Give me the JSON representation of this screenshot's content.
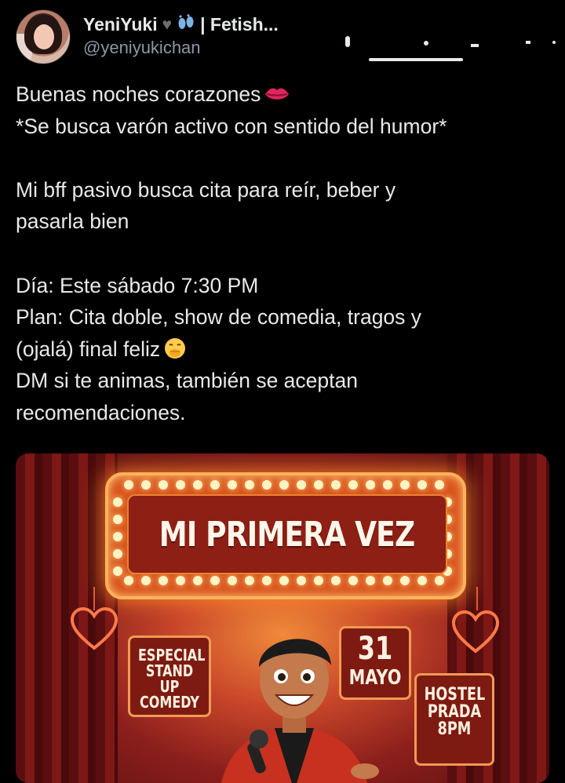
{
  "tweet": {
    "author": {
      "display_name": "YeniYuki",
      "name_suffix": "| Fetish...",
      "handle": "@yeniyukichan",
      "badges": [
        "black-heart-icon",
        "footprints-icon"
      ]
    },
    "lines": [
      "Buenas noches corazones",
      "*Se busca varón activo con sentido del humor*",
      "",
      "Mi bff pasivo busca cita para reír, beber y",
      "pasarla bien",
      "",
      "Día: Este sábado 7:30 PM",
      "Plan: Cita doble, show de comedia, tragos y",
      "(ojalá) final feliz",
      "DM si te animas, también se aceptan",
      "recomendaciones."
    ],
    "emojis": [
      "kiss-mark-icon",
      "face-with-hand-over-mouth-icon"
    ]
  },
  "media": {
    "marquee_title": "MI PRIMERA VEZ",
    "sign_especial": [
      "ESPECIAL",
      "STAND UP",
      "COMEDY"
    ],
    "date_day": "31",
    "date_month": "MAYO",
    "venue": [
      "HOSTEL",
      "PRADA",
      "8PM"
    ]
  },
  "colors": {
    "background": "#000000",
    "text": "#e7e9ea",
    "handle": "#8b98a5",
    "poster_red": "#8c1f1c",
    "poster_orange": "#f08a3a"
  }
}
